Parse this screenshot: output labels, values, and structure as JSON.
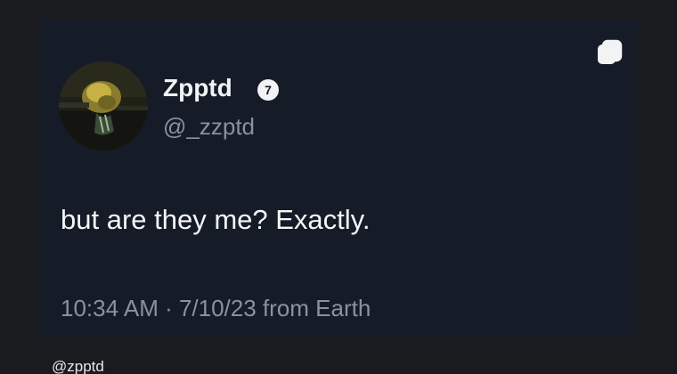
{
  "tweet": {
    "display_name": "Zpptd",
    "verified_badge_icon": "verified-badge-icon",
    "verified_badge_glyph": "7",
    "handle": "@_zzptd",
    "text": "but are they me? Exactly.",
    "meta": "10:34 AM · 7/10/23 from Earth",
    "copy_icon": "copy-icon"
  },
  "footer": {
    "handle": "@zpptd"
  },
  "colors": {
    "page_background": "#1a1b1f",
    "card_background": "#161b28",
    "primary_text": "#f2f3f5",
    "secondary_text": "#8b929c"
  }
}
